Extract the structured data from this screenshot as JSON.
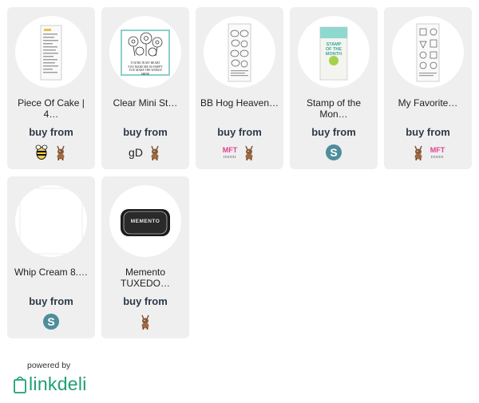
{
  "products": [
    {
      "title": "Piece Of Cake | 4…",
      "buy_label": "buy from",
      "thumb_icon": "clear-stamp-sheet-thumbnail",
      "shops": [
        "bee-shop-icon",
        "deer-shop-icon"
      ]
    },
    {
      "title": "Clear Mini St…",
      "buy_label": "buy from",
      "thumb_icon": "floral-stamp-thumbnail",
      "shops": [
        "gd-shop-icon",
        "deer-shop-icon"
      ],
      "thumb_text": [
        "YOU'RE IN MY HEART",
        "YOU MAKE ME SO HAPPY",
        "YOU MAKE THE WORLD SHINE"
      ]
    },
    {
      "title": "BB Hog Heaven…",
      "buy_label": "buy from",
      "thumb_icon": "hog-stamp-sheet-thumbnail",
      "shops": [
        "mft-shop-icon",
        "deer-shop-icon"
      ]
    },
    {
      "title": "Stamp of the Mon…",
      "buy_label": "buy from",
      "thumb_icon": "stamp-of-the-month-thumbnail",
      "shops": [
        "s-shop-icon"
      ],
      "thumb_text": [
        "STAMP",
        "OF THE",
        "MONTH"
      ]
    },
    {
      "title": "My Favorite…",
      "buy_label": "buy from",
      "thumb_icon": "favorite-stamp-sheet-thumbnail",
      "shops": [
        "deer-shop-icon",
        "mft-shop-icon"
      ]
    },
    {
      "title": "Whip Cream 8.…",
      "buy_label": "buy from",
      "thumb_icon": "white-cardstock-thumbnail",
      "shops": [
        "s-shop-icon"
      ]
    },
    {
      "title": "Memento TUXEDO…",
      "buy_label": "buy from",
      "thumb_icon": "ink-pad-thumbnail",
      "shops": [
        "deer-shop-icon"
      ],
      "thumb_text": [
        "MEMENTO"
      ]
    }
  ],
  "shop_labels": {
    "mft": "MFT",
    "gd": "gD",
    "s": "S"
  },
  "footer": {
    "powered_by": "powered by",
    "brand": "linkdeli"
  },
  "colors": {
    "card_bg": "#efefef",
    "buy_text": "#2e3a48",
    "brand_green": "#1f9f6f",
    "mft_pink": "#e0428f",
    "s_teal": "#4f8d9c"
  }
}
